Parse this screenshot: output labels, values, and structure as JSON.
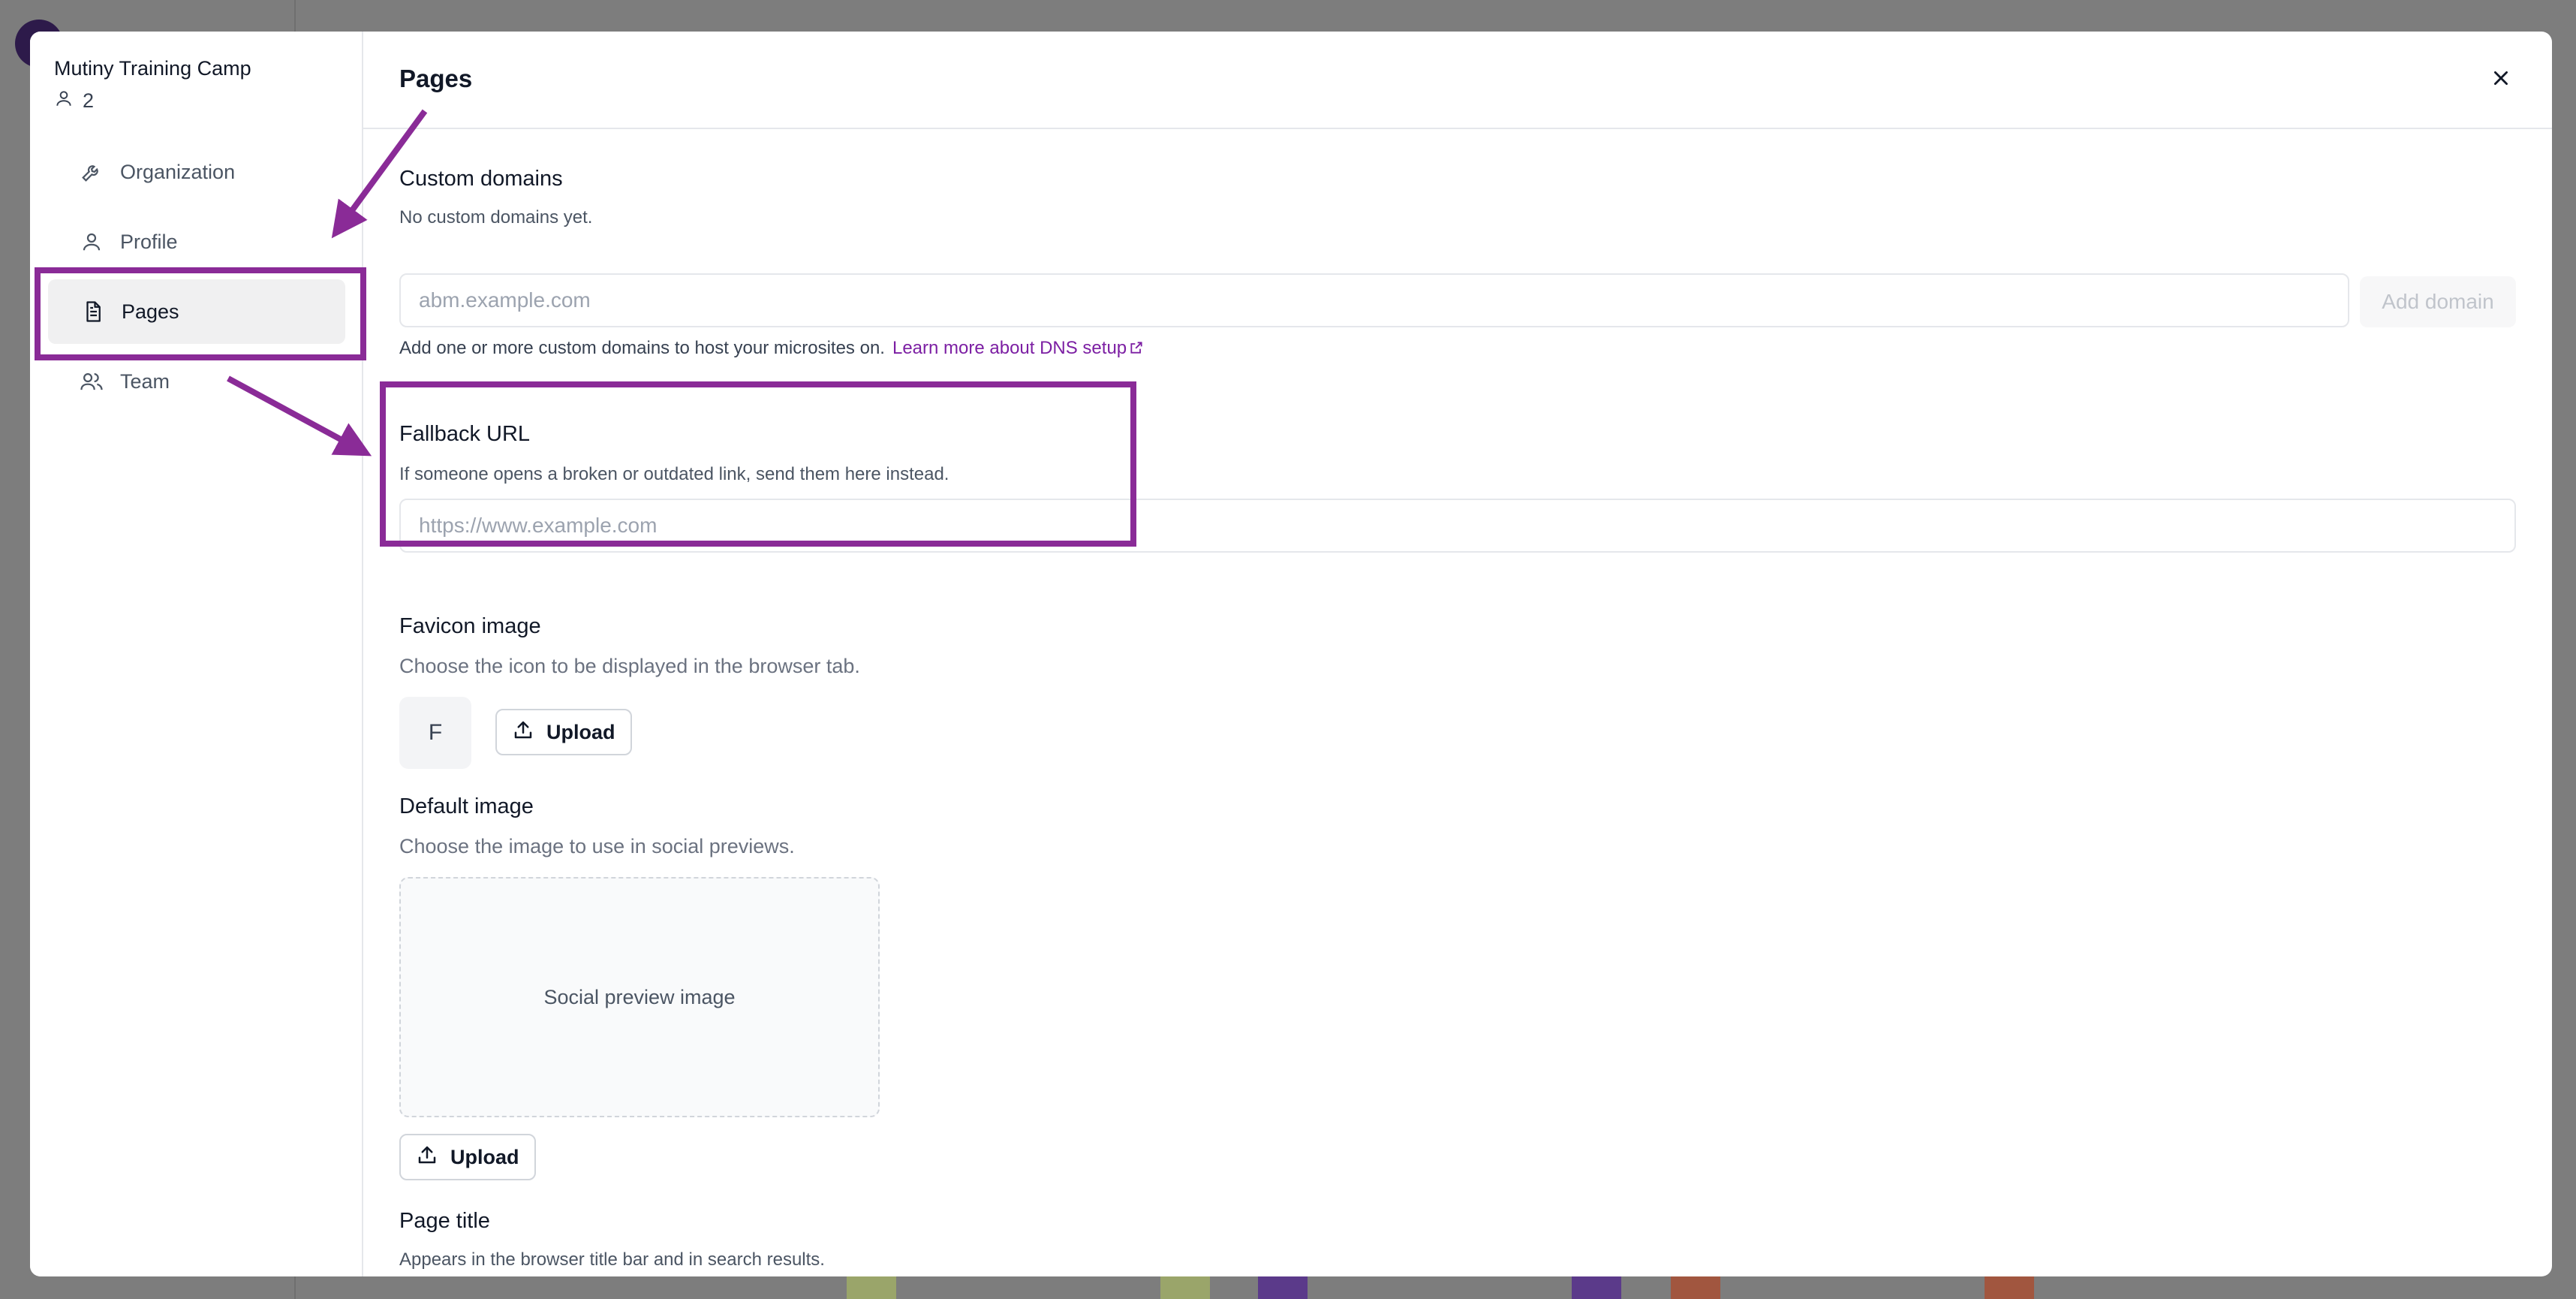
{
  "sidebar": {
    "org_name": "Mutiny Training Camp",
    "member_count": "2",
    "items": [
      {
        "label": "Organization",
        "icon": "wrench-icon"
      },
      {
        "label": "Profile",
        "icon": "user-icon"
      },
      {
        "label": "Pages",
        "icon": "document-icon",
        "active": true
      },
      {
        "label": "Team",
        "icon": "users-icon"
      }
    ]
  },
  "header": {
    "title": "Pages"
  },
  "custom_domains": {
    "label": "Custom domains",
    "empty_text": "No custom domains yet.",
    "placeholder": "abm.example.com",
    "add_button": "Add domain",
    "helper": "Add one or more custom domains to host your microsites on.",
    "learn_more": "Learn more about DNS setup"
  },
  "fallback_url": {
    "label": "Fallback URL",
    "description": "If someone opens a broken or outdated link, send them here instead.",
    "placeholder": "https://www.example.com"
  },
  "favicon": {
    "label": "Favicon image",
    "description": "Choose the icon to be displayed in the browser tab.",
    "preview_letter": "F",
    "upload_label": "Upload"
  },
  "default_image": {
    "label": "Default image",
    "description": "Choose the image to use in social previews.",
    "placeholder_text": "Social preview image",
    "upload_label": "Upload"
  },
  "page_title": {
    "label": "Page title",
    "description": "Appears in the browser title bar and in search results."
  },
  "colors": {
    "annotation": "#8a2b97",
    "link": "#7c1fa3",
    "overlay": "#7d7d7d"
  }
}
